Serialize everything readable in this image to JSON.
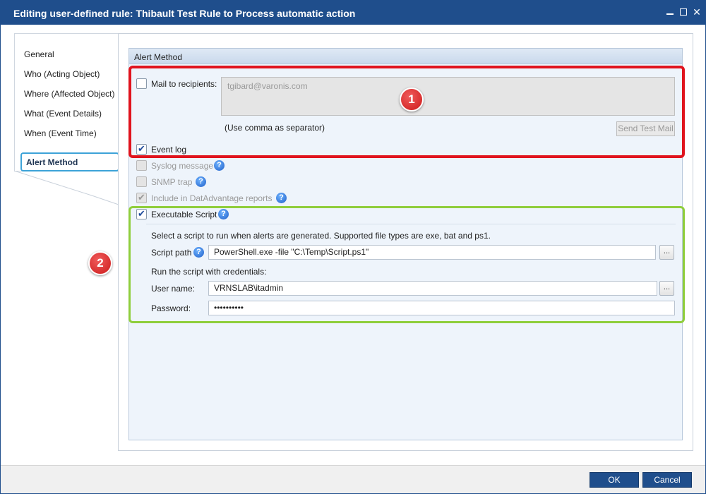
{
  "window": {
    "title": "Editing user-defined rule: Thibault Test Rule to Process automatic action"
  },
  "nav": {
    "items": [
      {
        "label": "General"
      },
      {
        "label": "Who (Acting Object)"
      },
      {
        "label": "Where (Affected Object)"
      },
      {
        "label": "What (Event Details)"
      },
      {
        "label": "When (Event Time)"
      },
      {
        "label": "Alert Method"
      }
    ],
    "active_index": 5
  },
  "alert_method": {
    "header": "Alert Method",
    "mail": {
      "label": "Mail to recipients:",
      "checked": false,
      "value": "tgibard@varonis.com",
      "hint": "(Use comma as separator)",
      "send_test_label": "Send Test Mail"
    },
    "event_log": {
      "label": "Event log",
      "checked": true
    },
    "syslog": {
      "label": "Syslog message",
      "checked": false,
      "enabled": false
    },
    "snmp": {
      "label": "SNMP trap",
      "checked": false,
      "enabled": false
    },
    "include_reports": {
      "label": "Include in DatAdvantage reports",
      "checked": true,
      "enabled": false
    },
    "script": {
      "label": "Executable Script",
      "checked": true,
      "description": "Select a script to run when alerts are generated. Supported file types are exe, bat and ps1.",
      "path_label": "Script path",
      "path_value": "PowerShell.exe -file \"C:\\Temp\\Script.ps1\"",
      "browse_label": "...",
      "credentials_label": "Run the script with credentials:",
      "username_label": "User name:",
      "username_value": "VRNSLAB\\itadmin",
      "password_label": "Password:",
      "password_value": "••••••••••"
    }
  },
  "annotations": {
    "badge_1": "1",
    "badge_2": "2",
    "red_box_color": "#e0141e",
    "green_box_color": "#8fce3c"
  },
  "footer": {
    "ok_label": "OK",
    "cancel_label": "Cancel"
  },
  "colors": {
    "titlebar": "#1f4e8c",
    "nav_active_border": "#3da3d8",
    "help_icon": "#1f5fc8"
  },
  "icons": {
    "help": "question-circle-icon",
    "minimize": "minimize-icon",
    "maximize": "maximize-icon",
    "close": "close-icon",
    "checkmark": "checkmark-icon"
  }
}
